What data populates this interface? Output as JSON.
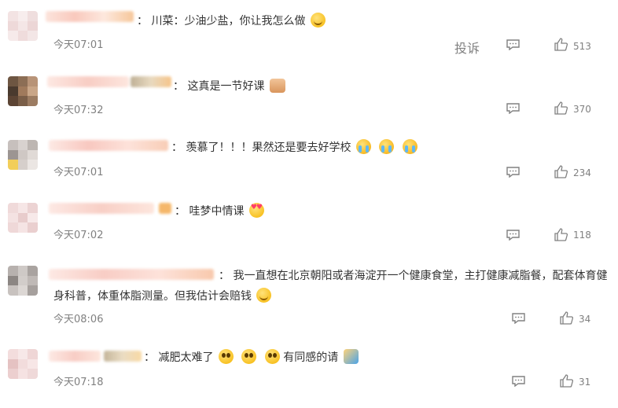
{
  "report_label": "投诉",
  "colors": {
    "icon": "#808080",
    "text": "#333333",
    "time": "#808080"
  },
  "comments": [
    {
      "sep": "：",
      "text": "川菜：少油少盐，你让我怎么做",
      "emojis": [
        "smiling-emoji"
      ],
      "time": "今天07:01",
      "likes": "513"
    },
    {
      "sep": "：",
      "text": "这真是一节好课",
      "emojis": [
        "thumbs-up-emoji"
      ],
      "time": "今天07:32",
      "likes": "370"
    },
    {
      "sep": "：",
      "text": "羡慕了！！！果然还是要去好学校",
      "emojis": [
        "crying-emoji",
        "crying-emoji",
        "crying-emoji"
      ],
      "time": "今天07:01",
      "likes": "234"
    },
    {
      "sep": "：",
      "text": "哇梦中情课",
      "emojis": [
        "heart-eyes-emoji"
      ],
      "time": "今天07:02",
      "likes": "118"
    },
    {
      "sep": "：",
      "text": "我一直想在北京朝阳或者海淀开一个健康食堂，主打健康减脂餐，配套体育健身科普，体重体脂测量。但我估计会赔钱",
      "emojis": [
        "smiling-emoji"
      ],
      "time": "今天08:06",
      "likes": "34"
    },
    {
      "sep": "：",
      "text": "减肥太难了",
      "text2": "有同感的请",
      "emojis": [
        "pleading-emoji",
        "pleading-emoji",
        "pleading-emoji"
      ],
      "emojis2": [
        "raised-hand-emoji"
      ],
      "time": "今天07:18",
      "likes": "31"
    }
  ]
}
